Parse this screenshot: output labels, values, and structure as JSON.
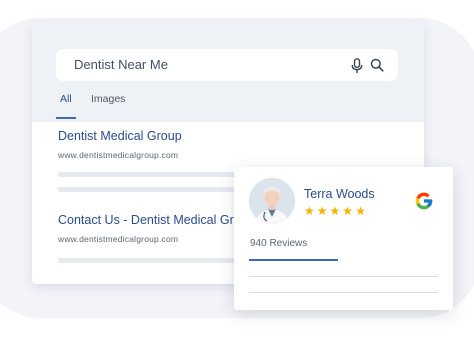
{
  "search": {
    "query": "Dentist Near Me",
    "tabs": [
      {
        "label": "All",
        "active": true
      },
      {
        "label": "Images",
        "active": false
      }
    ]
  },
  "results": [
    {
      "title": "Dentist Medical Group",
      "url": "www.dentistmedicalgroup.com"
    },
    {
      "title": "Contact Us - Dentist Medical Group",
      "url": "www.dentistmedicalgroup.com"
    }
  ],
  "review_card": {
    "name": "Terra Woods",
    "rating": 5,
    "reviews": "940 Reviews"
  },
  "colors": {
    "accent": "#3f67b4",
    "title": "#2b4c8c",
    "star": "#f5b400"
  },
  "icons": [
    "mic-icon",
    "search-icon",
    "google-icon",
    "star-icon",
    "avatar"
  ]
}
